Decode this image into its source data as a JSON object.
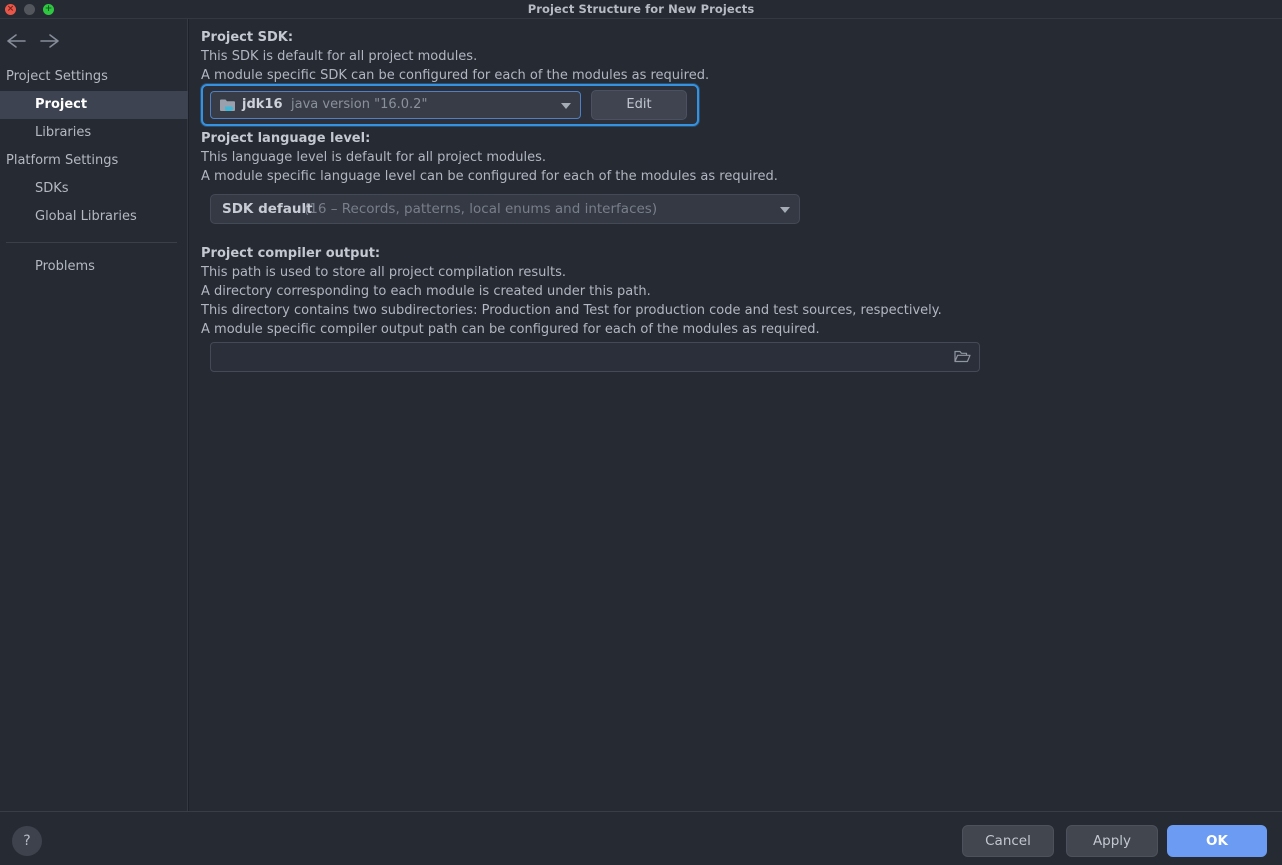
{
  "window": {
    "title": "Project Structure for New Projects",
    "controls": {
      "close": "close-button",
      "minimize": "minimize-button",
      "zoom": "zoom-button",
      "close_glyph": "×",
      "zoom_glyph": "+"
    }
  },
  "sidebar": {
    "back_label": "Back",
    "forward_label": "Forward",
    "groups": [
      {
        "label": "Project Settings",
        "items": [
          {
            "label": "Project",
            "selected": true
          },
          {
            "label": "Libraries",
            "selected": false
          }
        ]
      },
      {
        "label": "Platform Settings",
        "items": [
          {
            "label": "SDKs",
            "selected": false
          },
          {
            "label": "Global Libraries",
            "selected": false
          }
        ]
      }
    ],
    "extra": [
      {
        "label": "Problems",
        "selected": false
      }
    ]
  },
  "main": {
    "sdk": {
      "title": "Project SDK:",
      "desc1": "This SDK is default for all project modules.",
      "desc2": "A module specific SDK can be configured for each of the modules as required.",
      "selected_name": "jdk16",
      "selected_version": "java version \"16.0.2\"",
      "icon": "java-sdk-folder-icon",
      "edit_label": "Edit"
    },
    "language_level": {
      "title": "Project language level:",
      "desc1": "This language level is default for all project modules.",
      "desc2": "A module specific language level can be configured for each of the modules as required.",
      "selected": "SDK default",
      "detail": "(16 – Records, patterns, local enums and interfaces)"
    },
    "compiler_output": {
      "title": "Project compiler output:",
      "desc1": "This path is used to store all project compilation results.",
      "desc2": "A directory corresponding to each module is created under this path.",
      "desc3": "This directory contains two subdirectories: Production and Test for production code and test sources, respectively.",
      "desc4": "A module specific compiler output path can be configured for each of the modules as required.",
      "value": "",
      "placeholder": "",
      "browse_icon": "folder-open-icon"
    }
  },
  "footer": {
    "help_label": "?",
    "cancel_label": "Cancel",
    "apply_label": "Apply",
    "ok_label": "OK"
  },
  "colors": {
    "background": "#262a33",
    "titlebar": "#262a33",
    "selection": "#3d4350",
    "focus_ring": "#3592e0",
    "primary_button": "#6b9bf2",
    "text": "#b1b6c0",
    "text_muted": "#8b919c"
  }
}
